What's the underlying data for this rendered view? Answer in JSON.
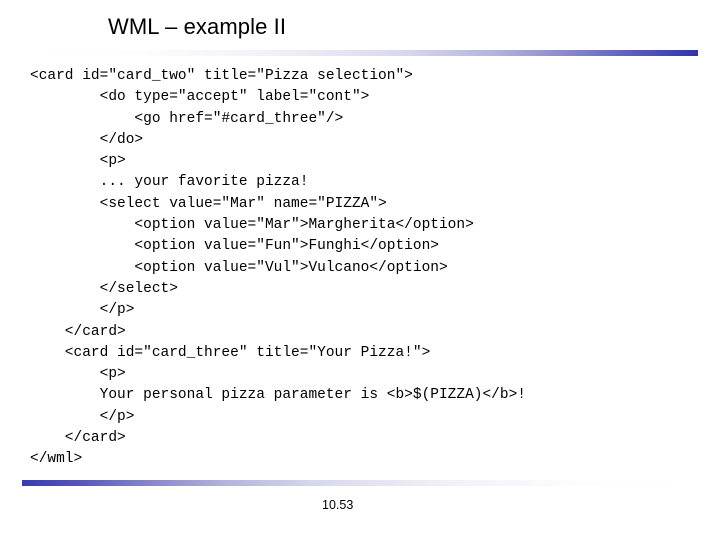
{
  "slide": {
    "title": "WML – example II",
    "footer_number": "10.53",
    "accent_color": "#3333ac",
    "background_color": "#ffffff",
    "text_color": "#000000"
  },
  "code": {
    "language": "wml",
    "lines": [
      "<card id=\"card_two\" title=\"Pizza selection\">",
      "        <do type=\"accept\" label=\"cont\">",
      "            <go href=\"#card_three\"/>",
      "        </do>",
      "        <p>",
      "        ... your favorite pizza!",
      "        <select value=\"Mar\" name=\"PIZZA\">",
      "            <option value=\"Mar\">Margherita</option>",
      "            <option value=\"Fun\">Funghi</option>",
      "            <option value=\"Vul\">Vulcano</option>",
      "        </select>",
      "        </p>",
      "    </card>",
      "    <card id=\"card_three\" title=\"Your Pizza!\">",
      "        <p>",
      "        Your personal pizza parameter is <b>$(PIZZA)</b>!",
      "        </p>",
      "    </card>",
      "</wml>"
    ]
  }
}
